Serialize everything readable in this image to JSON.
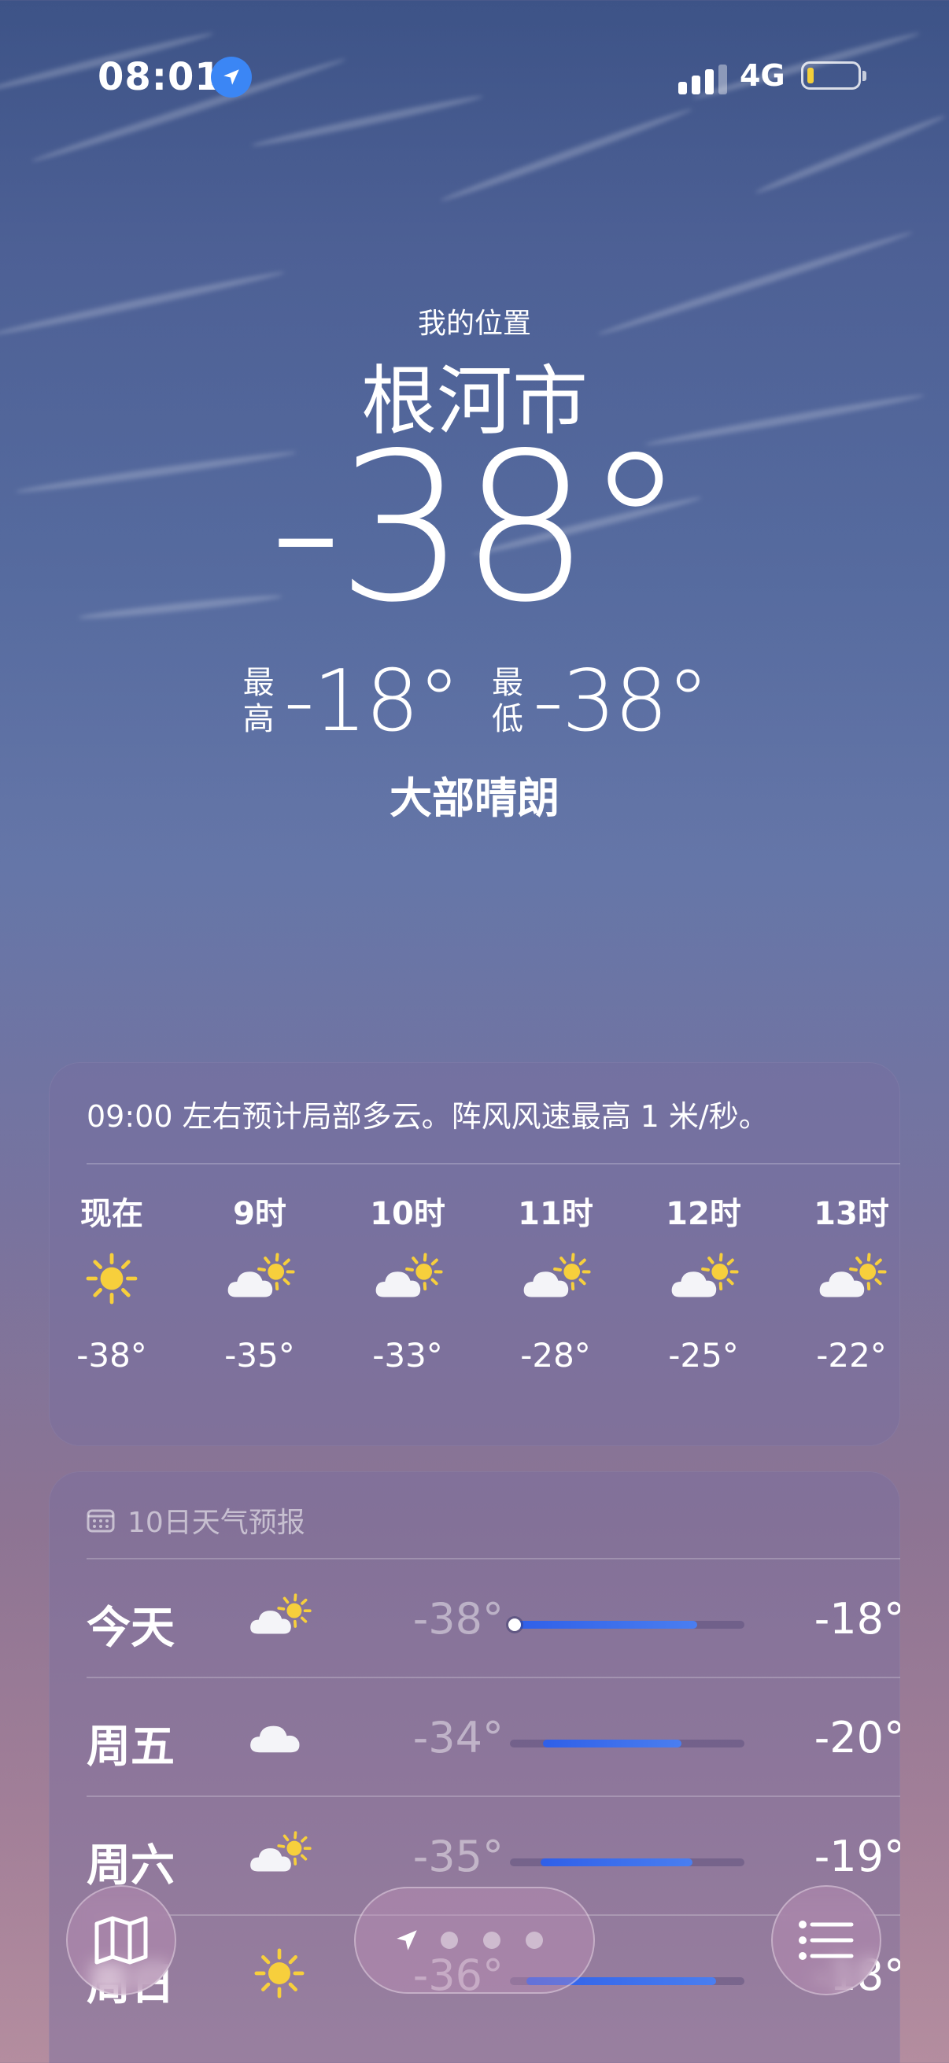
{
  "status_bar": {
    "time": "08:01",
    "network": "4G",
    "battery_level": 0.1,
    "battery_color": "#f3cf3a",
    "location_icon": "location-arrow-icon"
  },
  "header": {
    "my_location": "我的位置",
    "city": "根河市",
    "current_temp": "-38°",
    "high_label": "最高",
    "high_temp": "-18°",
    "low_label": "最低",
    "low_temp": "-38°",
    "condition": "大部晴朗"
  },
  "hourly": {
    "summary": "09:00 左右预计局部多云。阵风风速最高 1 米/秒。",
    "hours": [
      {
        "label": "现在",
        "icon": "sun-icon",
        "temp": "-38°"
      },
      {
        "label": "9时",
        "icon": "partly-cloudy-icon",
        "temp": "-35°"
      },
      {
        "label": "10时",
        "icon": "partly-cloudy-icon",
        "temp": "-33°"
      },
      {
        "label": "11时",
        "icon": "partly-cloudy-icon",
        "temp": "-28°"
      },
      {
        "label": "12时",
        "icon": "partly-cloudy-icon",
        "temp": "-25°"
      },
      {
        "label": "13时",
        "icon": "partly-cloudy-icon",
        "temp": "-22°"
      }
    ]
  },
  "daily": {
    "header": "10日天气预报",
    "days": [
      {
        "name": "今天",
        "icon": "partly-cloudy-icon",
        "low": "-38°",
        "high": "-18°",
        "range_start": 0.02,
        "range_end": 0.8,
        "current_marker": 0.02
      },
      {
        "name": "周五",
        "icon": "cloud-icon",
        "low": "-34°",
        "high": "-20°",
        "range_start": 0.14,
        "range_end": 0.73
      },
      {
        "name": "周六",
        "icon": "partly-cloudy-icon",
        "low": "-35°",
        "high": "-19°",
        "range_start": 0.13,
        "range_end": 0.78
      },
      {
        "name": "周日",
        "icon": "sun-icon",
        "low": "-36°",
        "high": "-18°",
        "range_start": 0.07,
        "range_end": 0.88
      }
    ]
  },
  "toolbar": {
    "map_icon": "map-icon",
    "list_icon": "list-icon",
    "current_page_icon": "location-arrow-icon"
  },
  "colors": {
    "accent_blue": "#3b86f5",
    "range_blue": "#2f5fe8",
    "sun_yellow": "#f7cf3c"
  }
}
